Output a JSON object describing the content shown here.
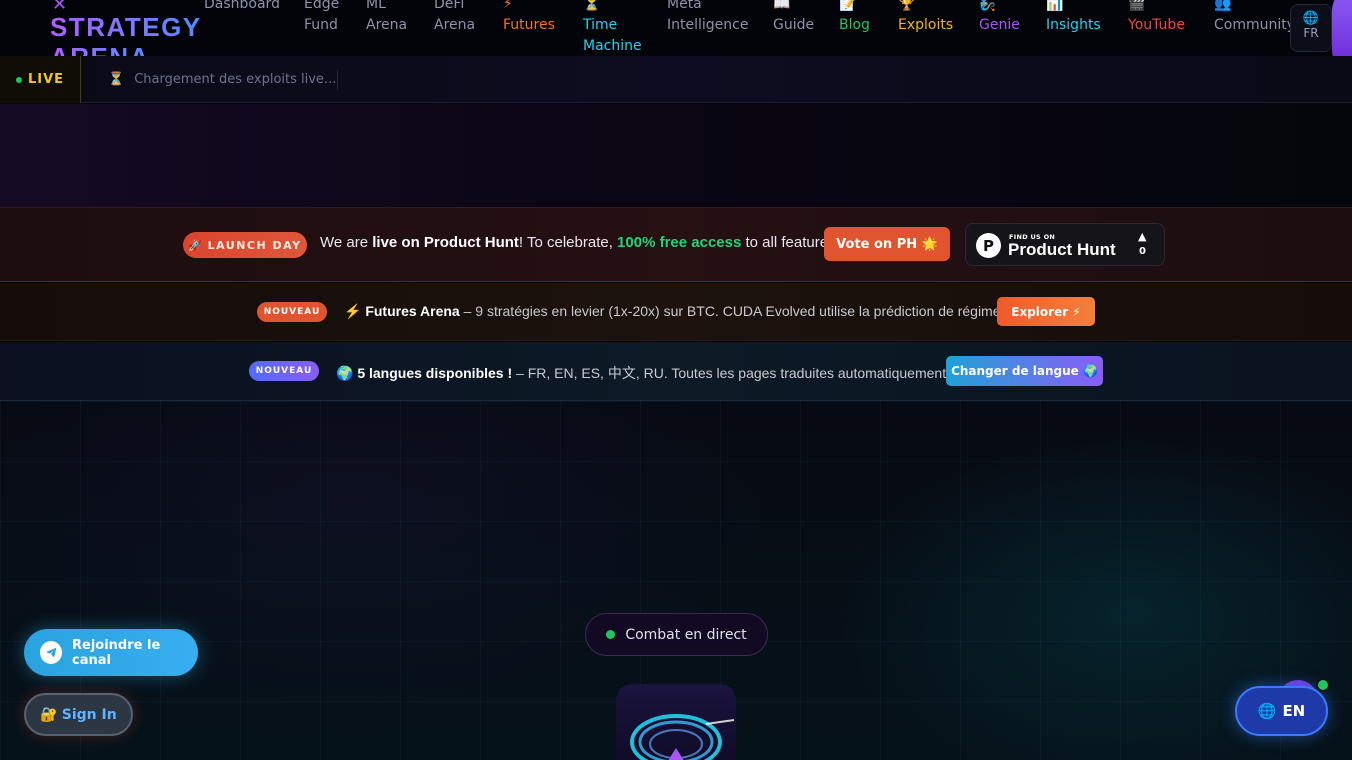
{
  "brand": {
    "line1": "STRATEGY",
    "line2": "ARENA",
    "mark": "✕",
    "color_primary": "#b05cff",
    "color_secondary": "#4f8cff"
  },
  "nav": [
    {
      "icon": "",
      "label": "Dashboard",
      "color": "#8d92a8"
    },
    {
      "icon": "",
      "label": "Edge\nFund",
      "color": "#8d92a8"
    },
    {
      "icon": "",
      "label": "ML\nArena",
      "color": "#8d92a8"
    },
    {
      "icon": "",
      "label": "DeFi\nArena",
      "color": "#8d92a8"
    },
    {
      "icon": "⚡",
      "label": "Futures",
      "color": "#f97316"
    },
    {
      "icon": "⏳",
      "label": "Time\nMachine",
      "color": "#22d3ee"
    },
    {
      "icon": "",
      "label": "Meta\nIntelligence",
      "color": "#8d92a8"
    },
    {
      "icon": "📖",
      "label": "Guide",
      "color": "#8d92a8"
    },
    {
      "icon": "📝",
      "label": "Blog",
      "color": "#22c55e"
    },
    {
      "icon": "🏆",
      "label": "Exploits",
      "color": "#f5b800"
    },
    {
      "icon": "🧞",
      "label": "Genie",
      "color": "#a855f7"
    },
    {
      "icon": "📊",
      "label": "Insights",
      "color": "#22d3ee"
    },
    {
      "icon": "🎬",
      "label": "YouTube",
      "color": "#ef4444"
    },
    {
      "icon": "👥",
      "label": "Community",
      "color": "#8d92a8"
    }
  ],
  "lang_switch": {
    "icon": "🌐",
    "code": "FR"
  },
  "ticker": {
    "live_label": "LIVE",
    "icon": "⏳",
    "message": "Chargement des exploits live..."
  },
  "ph_banner": {
    "pill_icon": "🚀",
    "pill_label": "LAUNCH DAY",
    "text_before": "We are ",
    "text_bold": "live on Product Hunt",
    "text_mid": "! To celebrate, ",
    "text_free": "100% free access",
    "text_after": " to all features!",
    "vote_label": "Vote on PH 🌟",
    "badge_logo": "P",
    "badge_find": "FIND US ON",
    "badge_name": "Product Hunt",
    "badge_arrow": "▲",
    "badge_count": "0"
  },
  "futures_banner": {
    "tag": "NOUVEAU",
    "icon": "⚡",
    "title": "Futures Arena",
    "text": " – 9 stratégies en levier (1x-20x) sur BTC. CUDA Evolved utilise la prédiction de régime !",
    "button": "Explorer ⚡"
  },
  "lang_banner": {
    "tag": "NOUVEAU",
    "icon": "🌍",
    "title": "5 langues disponibles !",
    "text": " – FR, EN, ES, 中文, RU. Toutes les pages traduites automatiquement !",
    "button": "Changer de langue 🌍"
  },
  "hero": {
    "combat_label": "Combat en direct"
  },
  "floating": {
    "telegram_label": "Rejoindre le canal",
    "signin_icon": "🔐",
    "signin_label": "Sign In",
    "en_icon": "🌐",
    "en_label": "EN"
  }
}
